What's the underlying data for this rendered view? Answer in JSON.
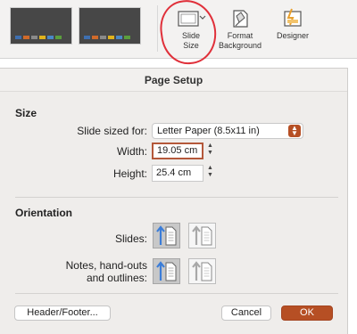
{
  "ribbon": {
    "slide_size_label_line1": "Slide",
    "slide_size_label_line2": "Size",
    "format_background_line1": "Format",
    "format_background_line2": "Background",
    "designer_label": "Designer",
    "slide_size_icon": "slide-size-icon",
    "format_background_icon": "format-background-icon",
    "designer_icon": "designer-icon"
  },
  "dialog": {
    "title": "Page Setup",
    "size_section": {
      "heading": "Size",
      "slide_sized_for_label": "Slide sized for:",
      "slide_sized_for_value": "Letter Paper (8.5x11 in)",
      "width_label": "Width:",
      "width_value": "19.05 cm",
      "height_label": "Height:",
      "height_value": "25.4 cm"
    },
    "orientation_section": {
      "heading": "Orientation",
      "slides_label": "Slides:",
      "notes_label_line1": "Notes, hand-outs",
      "notes_label_line2": "and outlines:",
      "slides_selected": "portrait",
      "notes_selected": "portrait"
    },
    "buttons": {
      "header_footer": "Header/Footer...",
      "cancel": "Cancel",
      "ok": "OK"
    }
  },
  "colors": {
    "accent": "#b64f24",
    "annotation_circle": "#e0303a",
    "portrait_arrow": "#3b7dd8"
  }
}
